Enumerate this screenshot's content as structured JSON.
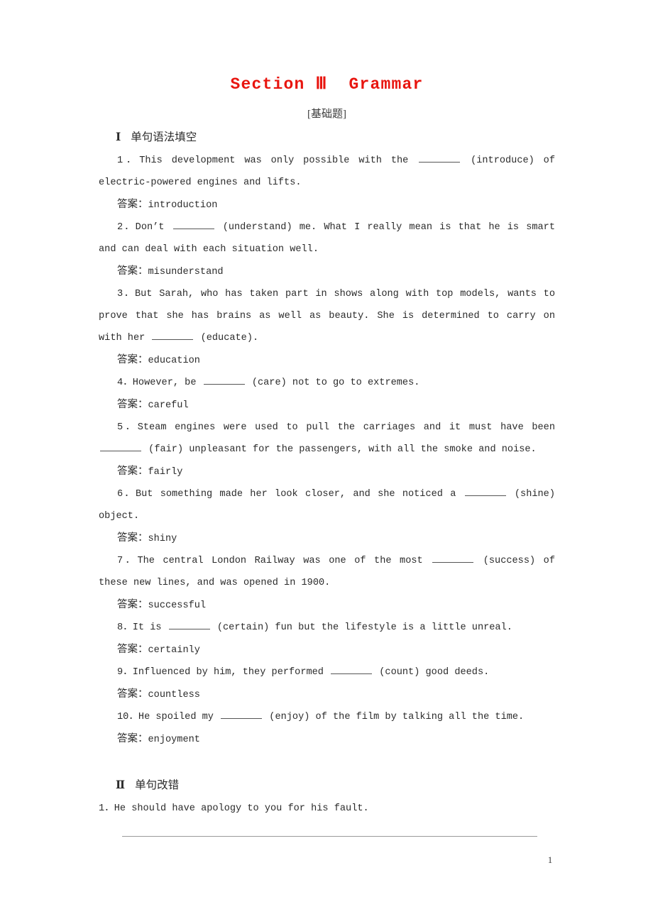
{
  "document": {
    "title": "Section Ⅲ  Grammar",
    "title_color": "#e8150f",
    "subtitle": "[基础题]",
    "page_number": "1"
  },
  "sections": [
    {
      "numeral": "Ⅰ",
      "label": "单句语法填空",
      "items": [
        {
          "q_pre": "1．This development was only possible with the ",
          "q_post": " (introduce) of electric-powered engines and lifts.",
          "answer_label": "答案：",
          "answer": "introduction"
        },
        {
          "q_pre": "2．Don’t ",
          "q_post": " (understand) me. What I really mean is that he is smart and can deal with each situation well.",
          "answer_label": "答案：",
          "answer": "misunderstand"
        },
        {
          "q_pre": "3．But Sarah, who has taken part in shows along with top models, wants to prove that she has brains as well as beauty. She is determined to carry on with her ",
          "q_post": " (educate).",
          "answer_label": "答案：",
          "answer": "education"
        },
        {
          "q_pre": "4．However, be ",
          "q_post": " (care) not to go to extremes.",
          "answer_label": "答案：",
          "answer": "careful"
        },
        {
          "q_pre": "5．Steam engines were used to pull the carriages and it must have been ",
          "q_post": " (fair) unpleasant for the passengers, with all the smoke and noise.",
          "answer_label": "答案：",
          "answer": "fairly"
        },
        {
          "q_pre": "6．But something made her look closer, and she noticed a ",
          "q_post": " (shine) object.",
          "answer_label": "答案：",
          "answer": "shiny"
        },
        {
          "q_pre": "7．The central London Railway was one of the most ",
          "q_post": " (success) of these new lines, and was opened in 1900.",
          "answer_label": "答案：",
          "answer": "successful"
        },
        {
          "q_pre": "8．It is ",
          "q_post": " (certain) fun but the lifestyle is a little unreal.",
          "answer_label": "答案：",
          "answer": "certainly"
        },
        {
          "q_pre": "9．Influenced by him, they performed ",
          "q_post": " (count) good deeds.",
          "answer_label": "答案：",
          "answer": "countless"
        },
        {
          "q_pre": "10．He spoiled my ",
          "q_post": " (enjoy) of the film by talking all the time.",
          "answer_label": "答案：",
          "answer": "enjoyment"
        }
      ]
    },
    {
      "numeral": "Ⅱ",
      "label": "单句改错",
      "items": [
        {
          "q_full": "1．He should have apology to you for his fault."
        }
      ]
    }
  ]
}
